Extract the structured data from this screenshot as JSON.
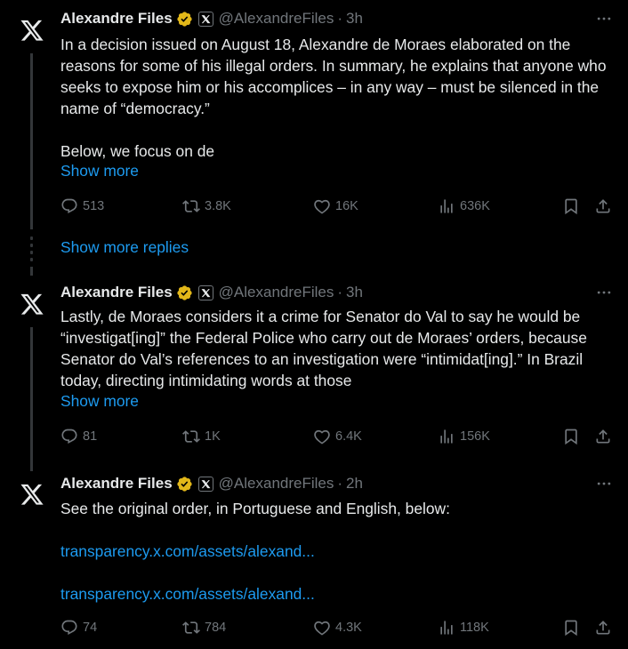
{
  "tweets": [
    {
      "name": "Alexandre Files",
      "handle": "@AlexandreFiles",
      "dot": "·",
      "time": "3h",
      "paragraphs": [
        "In a decision issued on August 18, Alexandre de Moraes elaborated on the reasons for some of his illegal orders.  In summary, he explains that anyone who seeks to expose him or his accomplices – in any way – must be silenced in the name of “democracy.”",
        "Below, we focus on de"
      ],
      "show_more": "Show more",
      "replies": "513",
      "reposts": "3.8K",
      "likes": "16K",
      "views": "636K"
    },
    {
      "name": "Alexandre Files",
      "handle": "@AlexandreFiles",
      "dot": "·",
      "time": "3h",
      "paragraphs": [
        "Lastly, de Moraes considers it a crime for Senator do Val to say he would be “investigat[ing]” the Federal Police who carry out de Moraes’ orders, because Senator do Val’s references to an investigation were “intimidat[ing].” In Brazil today, directing intimidating words at those"
      ],
      "show_more": "Show more",
      "replies": "81",
      "reposts": "1K",
      "likes": "6.4K",
      "views": "156K"
    },
    {
      "name": "Alexandre Files",
      "handle": "@AlexandreFiles",
      "dot": "·",
      "time": "2h",
      "paragraphs": [
        "See the original order, in Portuguese and English, below:"
      ],
      "links": [
        "transparency.x.com/assets/alexand...",
        "transparency.x.com/assets/alexand..."
      ],
      "replies": "74",
      "reposts": "784",
      "likes": "4.3K",
      "views": "118K"
    }
  ],
  "show_more_replies": "Show more replies",
  "colors": {
    "background": "#000000",
    "text": "#e7e9ea",
    "muted": "#71767b",
    "link": "#1d9bf0",
    "verified": "#e2b719",
    "line": "#333639"
  },
  "icons": [
    "x-logo-icon",
    "verified-badge-icon",
    "x-affiliate-icon",
    "more-icon",
    "reply-icon",
    "repost-icon",
    "like-icon",
    "views-icon",
    "bookmark-icon",
    "share-icon"
  ]
}
